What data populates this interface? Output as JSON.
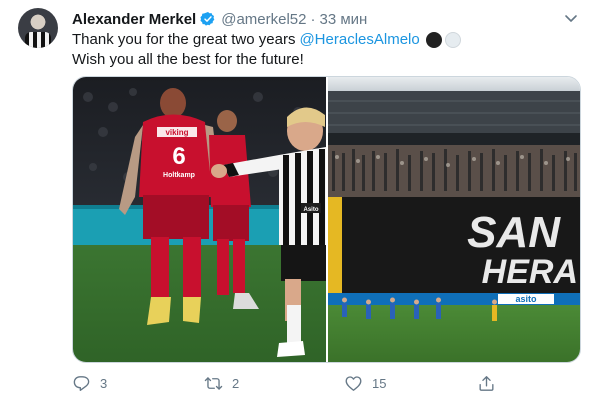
{
  "tweet": {
    "author_name": "Alexander Merkel",
    "handle": "@amerkel52",
    "separator": "·",
    "time": "33 мин",
    "text_line1": "Thank you for the great two years",
    "mention": "@HeraclesAlmelo",
    "text_line2": "Wish you all the best for the future!",
    "emojis": [
      "black-circle",
      "white-circle"
    ]
  },
  "media": {
    "left_photo": {
      "shirt_sponsor": "viking",
      "shirt_number": "6",
      "shirt_sponsor_2": "Holtkamp",
      "opponent_shirt_sponsor": "Asito"
    },
    "right_photo": {
      "banner_text_1": "SAN",
      "banner_text_2": "HERA",
      "board_text": "asito"
    }
  },
  "actions": {
    "reply_count": "3",
    "retweet_count": "2",
    "like_count": "15"
  },
  "colors": {
    "link": "#1b95e0",
    "verified": "#1da1f2",
    "muted": "#657786",
    "red_kit": "#c8102e",
    "pitch": "#3f7a2e"
  },
  "icons": [
    "verified-badge-icon",
    "chevron-down-icon",
    "reply-icon",
    "retweet-icon",
    "like-icon",
    "share-icon"
  ]
}
